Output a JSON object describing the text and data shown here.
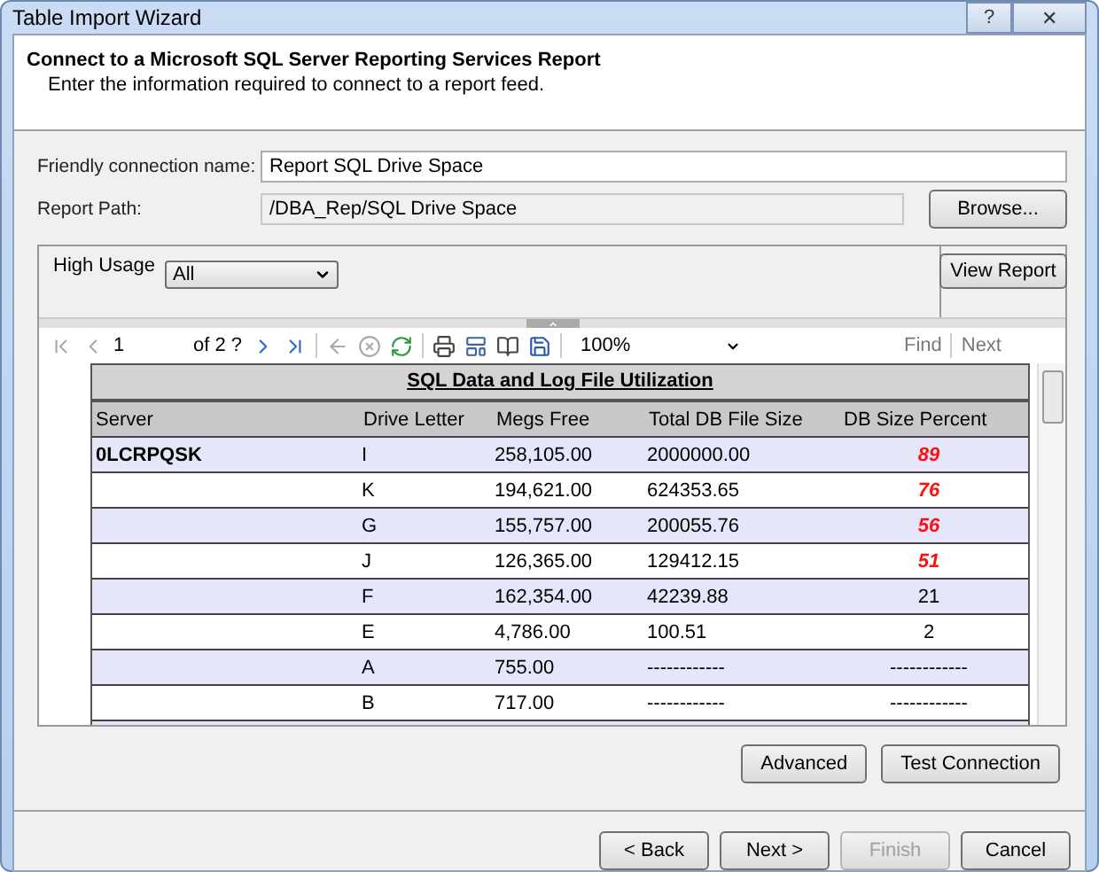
{
  "window": {
    "title": "Table Import Wizard",
    "help_button": "?",
    "close_button": "✕"
  },
  "header": {
    "title": "Connect to a Microsoft SQL Server Reporting Services Report",
    "subtitle": "Enter the information required to connect to a report feed."
  },
  "fields": [
    {
      "label": "Friendly connection name:",
      "value": "Report SQL Drive Space",
      "disabled": false
    },
    {
      "label": "Report Path:",
      "value": "/DBA_Rep/SQL Drive Space",
      "disabled": true,
      "button": "Browse..."
    }
  ],
  "parameters": {
    "label": "High Usage",
    "value": "All",
    "button": "View Report"
  },
  "toolbar": {
    "page": "1",
    "page_count": "of 2 ?",
    "zoom": "100%",
    "find": "Find",
    "next": "Next"
  },
  "report": {
    "title": "SQL Data and Log File Utilization",
    "columns": [
      "Server",
      "Drive Letter",
      "Megs Free",
      "Total DB File Size",
      "DB Size Percent"
    ],
    "rows": [
      {
        "server": "0LCRPQSK",
        "drive": "I",
        "free": "258,105.00",
        "total": "2000000.00",
        "percent": "89",
        "warning": true
      },
      {
        "drive": "K",
        "free": "194,621.00",
        "total": "624353.65",
        "percent": "76",
        "warning": true
      },
      {
        "drive": "G",
        "free": "155,757.00",
        "total": "200055.76",
        "percent": "56",
        "warning": true
      },
      {
        "drive": "J",
        "free": "126,365.00",
        "total": "129412.15",
        "percent": "51",
        "warning": true
      },
      {
        "drive": "F",
        "free": "162,354.00",
        "total": "42239.88",
        "percent": "21",
        "warning": false
      },
      {
        "drive": "E",
        "free": "4,786.00",
        "total": "100.51",
        "percent": "2",
        "warning": false
      },
      {
        "drive": "A",
        "free": "755.00",
        "total": "------------",
        "percent": "------------",
        "warning": false
      },
      {
        "drive": "B",
        "free": "717.00",
        "total": "------------",
        "percent": "------------",
        "warning": false
      },
      {
        "drive": "",
        "free": "",
        "total": "",
        "percent": ""
      }
    ]
  },
  "actions": [
    "Advanced",
    "Test Connection"
  ],
  "wizard_buttons": [
    {
      "label": "< Back",
      "disabled": false
    },
    {
      "label": "Next >",
      "disabled": false
    },
    {
      "label": "Finish",
      "disabled": true
    },
    {
      "label": "Cancel",
      "disabled": false
    }
  ]
}
